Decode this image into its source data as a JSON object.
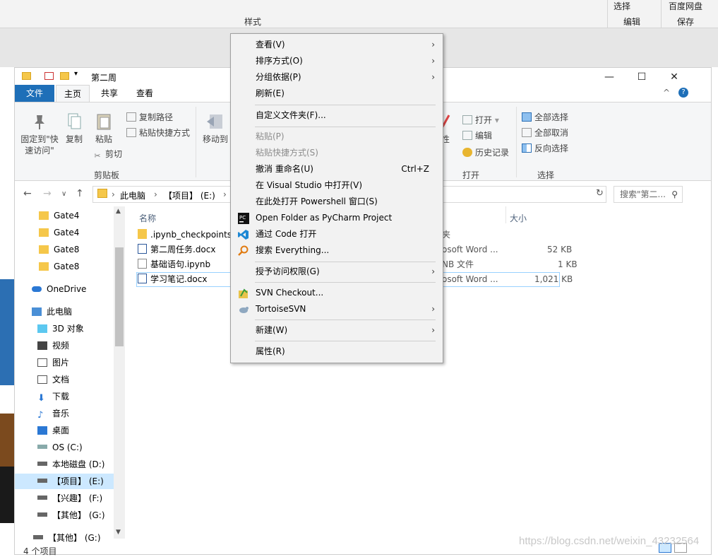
{
  "background": {
    "styles_group_label": "样式",
    "select_label": "选择",
    "edit_group_label": "编辑",
    "baidu_label": "百度网盘",
    "save_group_label": "保存"
  },
  "window": {
    "title": "第二周",
    "minimize": "—",
    "maximize": "☐",
    "close": "✕",
    "collapse": "^",
    "help": "?"
  },
  "tabs": {
    "file": "文件",
    "home": "主页",
    "share": "共享",
    "view": "查看"
  },
  "ribbon": {
    "pin_label": "固定到\"快\n速访问\"",
    "copy_label": "复制",
    "paste_label": "粘贴",
    "copy_path": "复制路径",
    "paste_shortcut": "粘贴快捷方式",
    "cut": "剪切",
    "clipboard_group": "剪贴板",
    "move_to": "移动到",
    "properties_partial": "性",
    "open": "打开",
    "edit": "编辑",
    "history": "历史记录",
    "open_group": "打开",
    "select_all": "全部选择",
    "select_none": "全部取消",
    "invert_selection": "反向选择",
    "select_group": "选择"
  },
  "address": {
    "crumbs": [
      "此电脑",
      "【项目】 (E:)"
    ],
    "search_placeholder": "搜索\"第二..."
  },
  "nav": {
    "items": [
      "Gate4",
      "Gate4",
      "Gate8",
      "Gate8",
      "OneDrive",
      "此电脑",
      "3D 对象",
      "视频",
      "图片",
      "文档",
      "下载",
      "音乐",
      "桌面",
      "OS (C:)",
      "本地磁盘 (D:)",
      "【项目】 (E:)",
      "【兴趣】 (F:)",
      "【其他】 (G:)",
      "【其他】 (G:)"
    ]
  },
  "content": {
    "columns": {
      "name": "名称",
      "size": "大小"
    },
    "files": [
      {
        "name": ".ipynb_checkpoints",
        "type": "夹",
        "size": ""
      },
      {
        "name": "第二周任务.docx",
        "type": "osoft Word ...",
        "size": "52 KB"
      },
      {
        "name": "基础语句.ipynb",
        "type": "NB 文件",
        "size": "1 KB"
      },
      {
        "name": "学习笔记.docx",
        "type": "osoft Word ...",
        "size": "1,021 KB"
      }
    ]
  },
  "status": {
    "count": "4 个项目"
  },
  "watermark": "https://blog.csdn.net/weixin_43232564",
  "context_menu": {
    "view": "查看(V)",
    "sort_by": "排序方式(O)",
    "group_by": "分组依据(P)",
    "refresh": "刷新(E)",
    "customize_folder": "自定义文件夹(F)...",
    "paste": "粘贴(P)",
    "paste_shortcut": "粘贴快捷方式(S)",
    "undo_rename": "撤消 重命名(U)",
    "undo_shortcut": "Ctrl+Z",
    "open_visual_studio": "在 Visual Studio 中打开(V)",
    "open_powershell": "在此处打开 Powershell 窗口(S)",
    "open_pycharm": "Open Folder as PyCharm Project",
    "open_code": "通过 Code 打开",
    "search_everything": "搜索 Everything...",
    "give_access": "授予访问权限(G)",
    "svn_checkout": "SVN Checkout...",
    "tortoise_svn": "TortoiseSVN",
    "new": "新建(W)",
    "properties": "属性(R)"
  },
  "colors": {
    "file_tab": "#1e6fb8",
    "selection": "#cce8ff",
    "menu_bg": "#f2f2f2"
  }
}
